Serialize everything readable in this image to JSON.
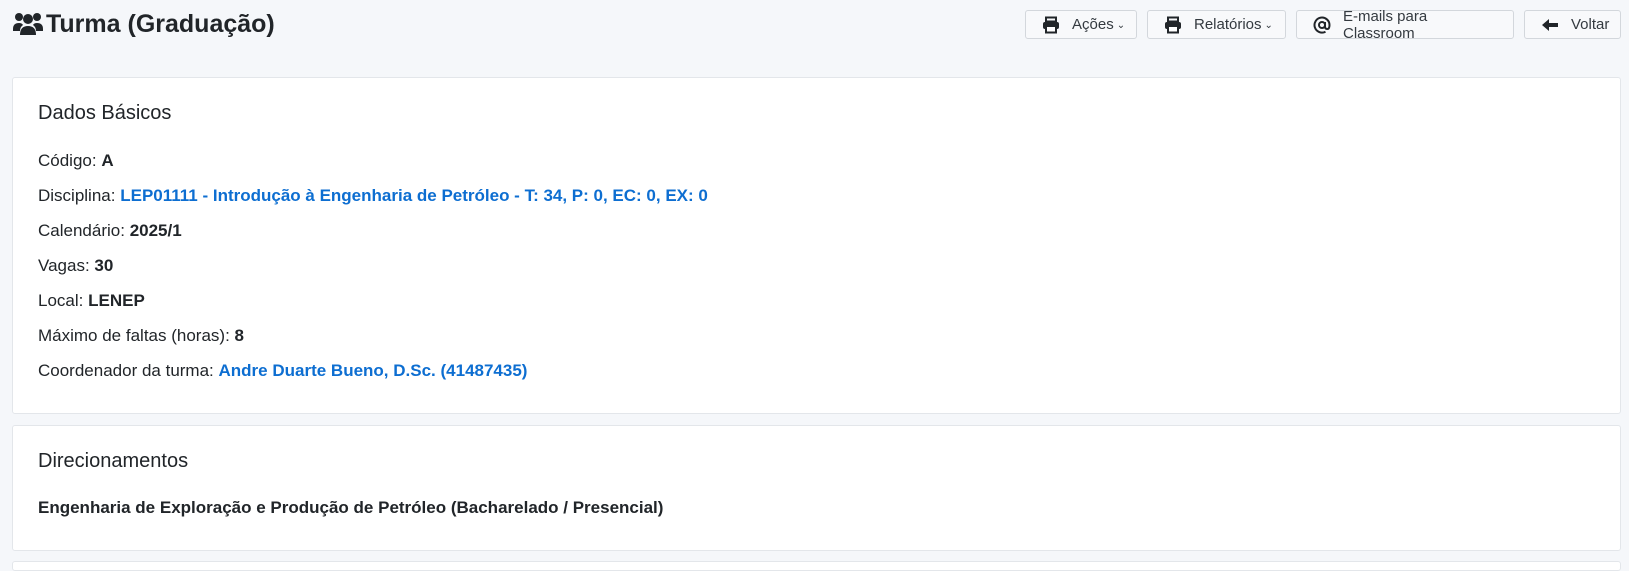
{
  "header": {
    "title": "Turma (Graduação)",
    "title_icon": "users-icon"
  },
  "toolbar": {
    "acoes": {
      "label": "Ações",
      "icon": "printer-icon"
    },
    "relatorios": {
      "label": "Relatórios",
      "icon": "printer-icon"
    },
    "emails": {
      "label": "E-mails para Classroom",
      "icon": "at-sign-icon"
    },
    "voltar": {
      "label": "Voltar",
      "icon": "arrow-left-icon"
    }
  },
  "basic": {
    "title": "Dados Básicos",
    "codigo": {
      "label": "Código:",
      "value": "A"
    },
    "disciplina": {
      "label": "Disciplina:",
      "value": "LEP01111 - Introdução à Engenharia de Petróleo - T: 34, P: 0, EC: 0, EX: 0"
    },
    "calendario": {
      "label": "Calendário:",
      "value": "2025/1"
    },
    "vagas": {
      "label": "Vagas:",
      "value": "30"
    },
    "local": {
      "label": "Local:",
      "value": "LENEP"
    },
    "maximo_faltas": {
      "label": "Máximo de faltas (horas):",
      "value": "8"
    },
    "coordenador": {
      "label": "Coordenador da turma:",
      "value": "Andre Duarte Bueno, D.Sc. (41487435)"
    }
  },
  "direcionamentos": {
    "title": "Direcionamentos",
    "items": [
      "Engenharia de Exploração e Produção de Petróleo (Bacharelado / Presencial)"
    ]
  },
  "colors": {
    "link": "#0d6ed1",
    "text": "#212529",
    "background": "#f5f7fa"
  }
}
